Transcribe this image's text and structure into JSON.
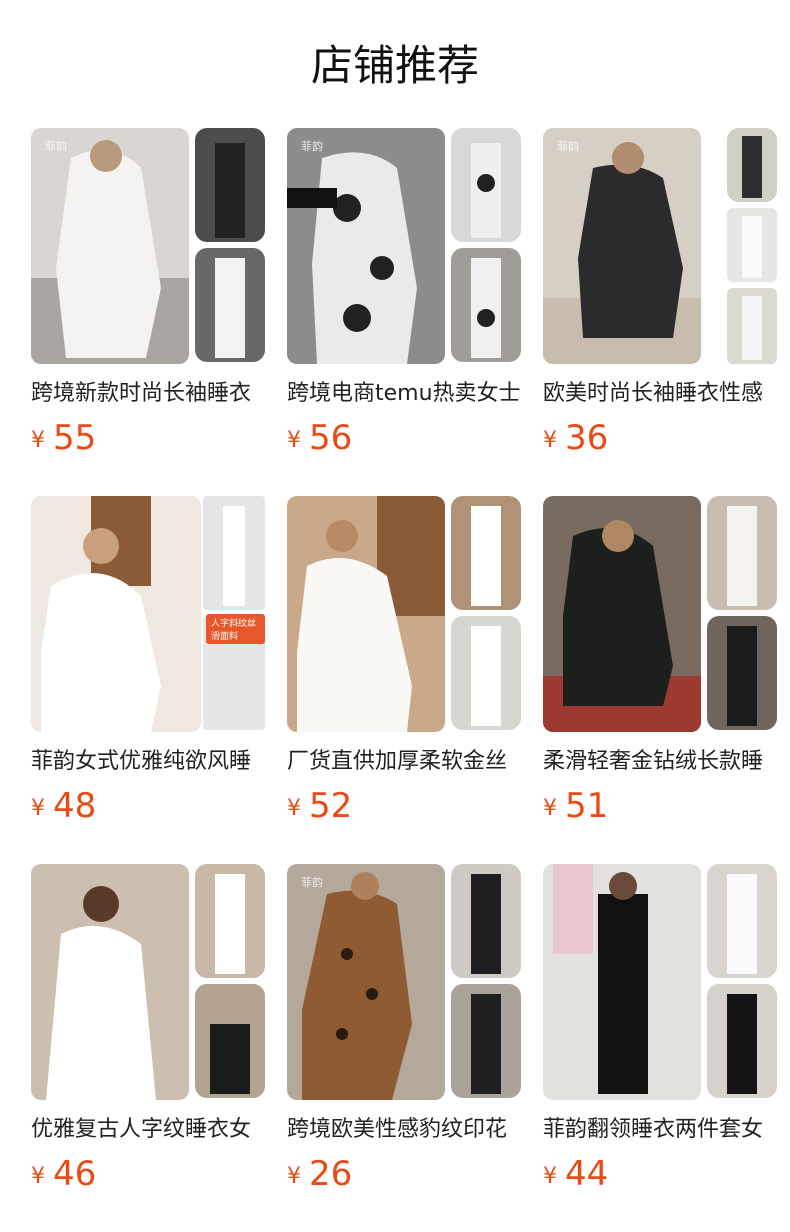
{
  "section_title": "店铺推荐",
  "currency": "¥",
  "products": [
    {
      "name": "跨境新款时尚长袖睡衣",
      "price": "55",
      "main_bg": "#d9d6d2",
      "accent": "#f4f3f1",
      "thumb1_bg": "#4c4c4c",
      "thumb2_bg": "#6a6866",
      "watermark": "菲韵"
    },
    {
      "name": "跨境电商temu热卖女士",
      "price": "56",
      "main_bg": "#8e8c8a",
      "accent": "#eaeaea",
      "thumb1_bg": "#d8d8d8",
      "thumb2_bg": "#a09c98",
      "watermark": "菲韵"
    },
    {
      "name": "欧美时尚长袖睡衣性感",
      "price": "36",
      "main_bg": "#d6cfc6",
      "accent": "#2b2b2b",
      "thumb1_bg": "#d2cec8",
      "thumb2_bg": "#e8e6e2",
      "watermark": "菲韵"
    },
    {
      "name": "菲韵女式优雅纯欲风睡",
      "price": "48",
      "main_bg": "#eee8e0",
      "accent": "#ffffff",
      "thumb1_bg": "#e3e6e4",
      "thumb2_bg": "#e6e6e8",
      "tag": "人字斜纹丝滑面料"
    },
    {
      "name": "厂货直供加厚柔软金丝",
      "price": "52",
      "main_bg": "#c9a98a",
      "accent": "#faf8f4",
      "thumb1_bg": "#b09277",
      "thumb2_bg": "#d4d6d0"
    },
    {
      "name": "柔滑轻奢金钻绒长款睡",
      "price": "51",
      "main_bg": "#7a6b60",
      "accent": "#1d1f1c",
      "thumb1_bg": "#c9bcb0",
      "thumb2_bg": "#6f675f"
    },
    {
      "name": "优雅复古人字纹睡衣女",
      "price": "46",
      "main_bg": "#cdbfb0",
      "accent": "#ffffff",
      "thumb1_bg": "#c7b8a8",
      "thumb2_bg": "#b2a491"
    },
    {
      "name": "跨境欧美性感豹纹印花",
      "price": "26",
      "main_bg": "#b4a89a",
      "accent": "#8e5b33",
      "thumb1_bg": "#cfcac4",
      "thumb2_bg": "#a9a39b",
      "watermark": "菲韵"
    },
    {
      "name": "菲韵翻领睡衣两件套女",
      "price": "44",
      "main_bg": "#e3e1dd",
      "accent": "#111111",
      "thumb1_bg": "#dad4cf",
      "thumb2_bg": "#d6d1cb"
    }
  ]
}
